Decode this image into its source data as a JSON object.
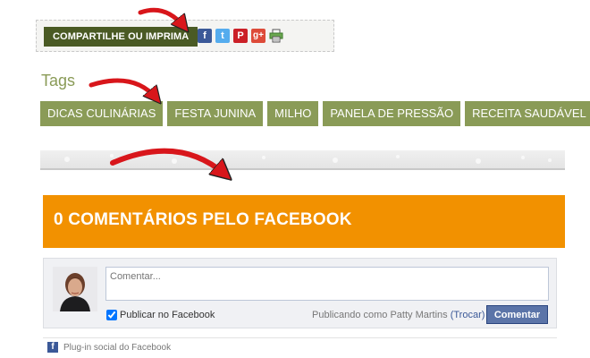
{
  "share": {
    "label": "COMPARTILHE OU IMPRIMA",
    "icons": [
      {
        "name": "facebook-icon",
        "glyph": "f",
        "color": "#3b5998"
      },
      {
        "name": "twitter-icon",
        "glyph": "t",
        "color": "#55acee"
      },
      {
        "name": "pinterest-icon",
        "glyph": "P",
        "color": "#cb2027"
      },
      {
        "name": "google-plus-icon",
        "glyph": "g+",
        "color": "#dd4b39"
      },
      {
        "name": "printer-icon",
        "glyph": "",
        "color": "#6aa84f"
      }
    ]
  },
  "tags": {
    "title": "Tags",
    "items": [
      "DICAS CULINÁRIAS",
      "FESTA JUNINA",
      "MILHO",
      "PANELA DE PRESSÃO",
      "RECEITA SAUDÁVEL"
    ]
  },
  "comments": {
    "heading": "0 COMENTÁRIOS PELO FACEBOOK",
    "placeholder": "Comentar...",
    "post_to_facebook": "Publicar no Facebook",
    "posting_as": "Publicando como Patty Martins",
    "switch_link": "(Trocar)",
    "submit": "Comentar",
    "plugin": "Plug-in social do Facebook"
  },
  "colors": {
    "accent_green": "#8a9b57",
    "dark_green": "#4a5a24",
    "orange": "#f29100",
    "facebook_blue": "#5b74a8",
    "arrow_red": "#d8161b"
  }
}
